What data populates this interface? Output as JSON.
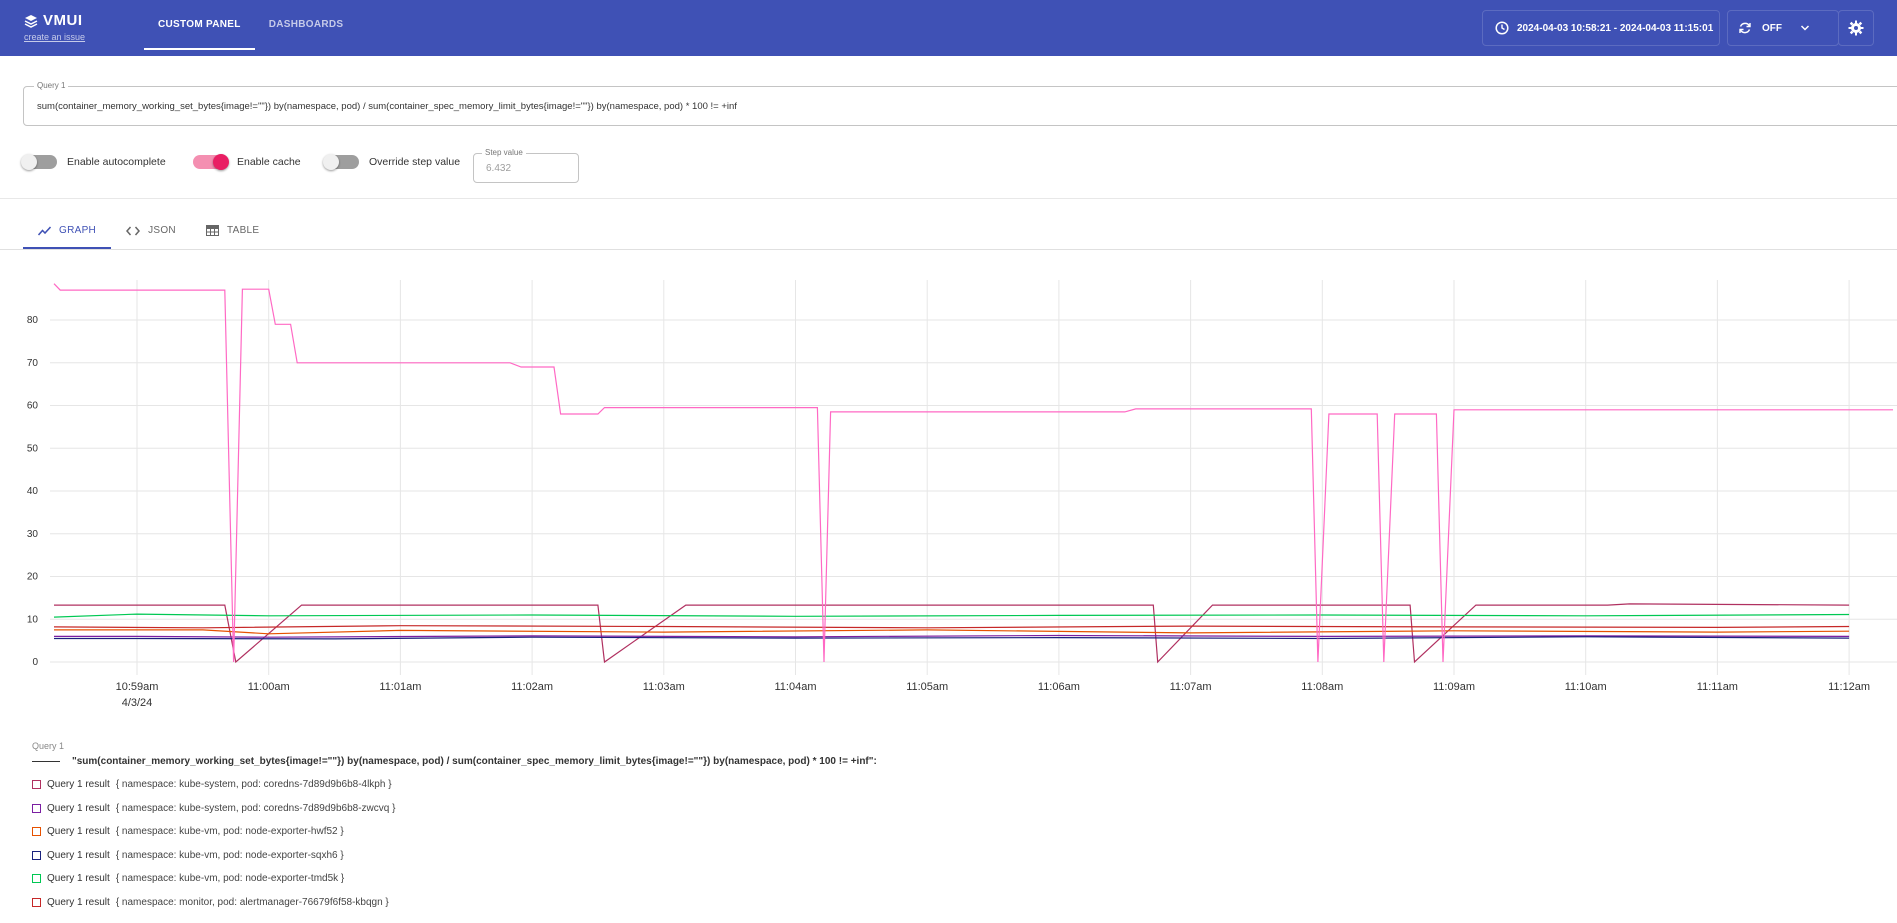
{
  "header": {
    "logo_text": "VMUI",
    "create_issue_link": "create an issue",
    "tabs": [
      {
        "label": "CUSTOM PANEL",
        "active": true
      },
      {
        "label": "DASHBOARDS",
        "active": false
      }
    ],
    "time_range": "2024-04-03 10:58:21 - 2024-04-03 11:15:01",
    "refresh_label": "OFF",
    "icons": {
      "time": "clock-icon",
      "refresh": "refresh-icon",
      "dropdown": "chevron-down-icon",
      "settings": "gear-icon",
      "logo": "layers-icon"
    },
    "background_color": "#3f51b5"
  },
  "query_panel": {
    "query_label": "Query 1",
    "query_value": "sum(container_memory_working_set_bytes{image!=\"\"}) by(namespace, pod) / sum(container_spec_memory_limit_bytes{image!=\"\"}) by(namespace, pod) * 100 != +inf",
    "toggles": [
      {
        "label": "Enable autocomplete",
        "on": false
      },
      {
        "label": "Enable cache",
        "on": true
      },
      {
        "label": "Override step value",
        "on": false
      }
    ],
    "step_label": "Step value",
    "step_value": "6.432"
  },
  "result_tabs": [
    {
      "label": "GRAPH",
      "icon": "line-chart-icon",
      "active": true
    },
    {
      "label": "JSON",
      "icon": "code-icon",
      "active": false
    },
    {
      "label": "TABLE",
      "icon": "table-icon",
      "active": false
    }
  ],
  "chart_data": {
    "type": "line",
    "title": "",
    "xlabel": "",
    "ylabel": "",
    "ylim": [
      0,
      90
    ],
    "y_ticks": [
      0,
      10,
      20,
      30,
      40,
      50,
      60,
      70,
      80
    ],
    "x_ticks": [
      "10:59am",
      "11:00am",
      "11:01am",
      "11:02am",
      "11:03am",
      "11:04am",
      "11:05am",
      "11:06am",
      "11:07am",
      "11:08am",
      "11:09am",
      "11:10am",
      "11:11am",
      "11:12am"
    ],
    "x_date_label": "4/3/24",
    "grid": true,
    "series": [
      {
        "name": "Query 1 result",
        "namespace": "kube-system",
        "pod": "coredns-7d89d9b6b8-4lkph",
        "color": "#b03060",
        "points": [
          [
            "10:58:21",
            13.3
          ],
          [
            "10:59:40",
            13.3
          ],
          [
            "10:59:45",
            0
          ],
          [
            "11:00:15",
            13.3
          ],
          [
            "11:02:30",
            13.3
          ],
          [
            "11:02:33",
            0
          ],
          [
            "11:03:10",
            13.3
          ],
          [
            "11:06:43",
            13.3
          ],
          [
            "11:06:45",
            0
          ],
          [
            "11:07:10",
            13.3
          ],
          [
            "11:08:40",
            13.3
          ],
          [
            "11:08:42",
            0
          ],
          [
            "11:09:10",
            13.3
          ],
          [
            "11:10:10",
            13.3
          ],
          [
            "11:10:20",
            13.6
          ],
          [
            "11:12:00",
            13.3
          ]
        ]
      },
      {
        "name": "Query 1 result",
        "namespace": "kube-system",
        "pod": "coredns-7d89d9b6b8-zwcvq",
        "color": "#7b1fa2",
        "points": [
          [
            "10:58:21",
            6.0
          ],
          [
            "10:59:00",
            6.0
          ],
          [
            "11:00:00",
            5.8
          ],
          [
            "11:02:00",
            6.1
          ],
          [
            "11:04:00",
            5.9
          ],
          [
            "11:06:00",
            6.2
          ],
          [
            "11:08:00",
            6.0
          ],
          [
            "11:10:00",
            6.1
          ],
          [
            "11:12:00",
            6.0
          ]
        ]
      },
      {
        "name": "Query 1 result",
        "namespace": "kube-vm",
        "pod": "node-exporter-hwf52",
        "color": "#e65100",
        "points": [
          [
            "10:58:21",
            7.5
          ],
          [
            "10:59:30",
            7.5
          ],
          [
            "11:00:00",
            6.6
          ],
          [
            "11:01:00",
            7.4
          ],
          [
            "11:03:00",
            7.0
          ],
          [
            "11:05:00",
            7.5
          ],
          [
            "11:07:00",
            6.8
          ],
          [
            "11:09:00",
            7.3
          ],
          [
            "11:11:00",
            7.0
          ],
          [
            "11:12:00",
            7.2
          ]
        ]
      },
      {
        "name": "Query 1 result",
        "namespace": "kube-vm",
        "pod": "node-exporter-sqxh6",
        "color": "#1a237e",
        "points": [
          [
            "10:58:21",
            5.5
          ],
          [
            "10:59:00",
            5.5
          ],
          [
            "11:00:30",
            5.4
          ],
          [
            "11:02:00",
            5.8
          ],
          [
            "11:04:00",
            5.6
          ],
          [
            "11:06:00",
            5.7
          ],
          [
            "11:08:00",
            5.5
          ],
          [
            "11:10:00",
            5.9
          ],
          [
            "11:12:00",
            5.6
          ]
        ]
      },
      {
        "name": "Query 1 result",
        "namespace": "kube-vm",
        "pod": "node-exporter-tmd5k",
        "color": "#00c853",
        "points": [
          [
            "10:58:21",
            10.5
          ],
          [
            "10:59:00",
            11.2
          ],
          [
            "11:00:00",
            10.8
          ],
          [
            "11:02:00",
            11.0
          ],
          [
            "11:04:00",
            10.7
          ],
          [
            "11:06:00",
            10.9
          ],
          [
            "11:08:00",
            11.0
          ],
          [
            "11:10:00",
            10.8
          ],
          [
            "11:12:00",
            11.1
          ]
        ]
      },
      {
        "name": "Query 1 result",
        "namespace": "monitor",
        "pod": "alertmanager-76679f6f58-kbqgn",
        "color": "#c62828",
        "points": [
          [
            "10:58:21",
            8.2
          ],
          [
            "10:59:30",
            8.0
          ],
          [
            "11:01:00",
            8.5
          ],
          [
            "11:03:00",
            8.3
          ],
          [
            "11:05:00",
            8.0
          ],
          [
            "11:07:00",
            8.4
          ],
          [
            "11:09:00",
            8.2
          ],
          [
            "11:11:00",
            8.1
          ],
          [
            "11:12:00",
            8.3
          ]
        ]
      },
      {
        "name": "Query 1 result",
        "namespace": "",
        "pod": "",
        "color": "#ff69c4",
        "points": [
          [
            "10:58:21",
            88.5
          ],
          [
            "10:58:25",
            87.0
          ],
          [
            "10:59:40",
            87.0
          ],
          [
            "10:59:44",
            0
          ],
          [
            "10:59:48",
            87.2
          ],
          [
            "11:00:00",
            87.2
          ],
          [
            "11:00:03",
            79.0
          ],
          [
            "11:00:10",
            79.0
          ],
          [
            "11:00:13",
            70.0
          ],
          [
            "11:01:50",
            70.0
          ],
          [
            "11:01:55",
            69.0
          ],
          [
            "11:02:10",
            69.0
          ],
          [
            "11:02:13",
            58.0
          ],
          [
            "11:02:30",
            58.0
          ],
          [
            "11:02:33",
            59.5
          ],
          [
            "11:04:10",
            59.5
          ],
          [
            "11:04:13",
            0
          ],
          [
            "11:04:16",
            58.5
          ],
          [
            "11:06:30",
            58.5
          ],
          [
            "11:06:35",
            59.2
          ],
          [
            "11:07:55",
            59.2
          ],
          [
            "11:07:58",
            0
          ],
          [
            "11:08:03",
            58.0
          ],
          [
            "11:08:25",
            58.0
          ],
          [
            "11:08:28",
            0
          ],
          [
            "11:08:33",
            58.0
          ],
          [
            "11:08:52",
            58.0
          ],
          [
            "11:08:55",
            0
          ],
          [
            "11:09:00",
            59.0
          ],
          [
            "11:12:20",
            59.0
          ]
        ]
      }
    ]
  },
  "legend": {
    "group_title": "Query 1",
    "query_text": "\"sum(container_memory_working_set_bytes{image!=\"\"}) by(namespace, pod) / sum(container_spec_memory_limit_bytes{image!=\"\"}) by(namespace, pod) * 100 != +inf\":",
    "items": [
      {
        "name": "Query 1 result",
        "labels": "{ namespace: kube-system,  pod: coredns-7d89d9b6b8-4lkph }",
        "color": "#b03060"
      },
      {
        "name": "Query 1 result",
        "labels": "{ namespace: kube-system,  pod: coredns-7d89d9b6b8-zwcvq }",
        "color": "#7b1fa2"
      },
      {
        "name": "Query 1 result",
        "labels": "{ namespace: kube-vm,  pod: node-exporter-hwf52 }",
        "color": "#e65100"
      },
      {
        "name": "Query 1 result",
        "labels": "{ namespace: kube-vm,  pod: node-exporter-sqxh6 }",
        "color": "#1a237e"
      },
      {
        "name": "Query 1 result",
        "labels": "{ namespace: kube-vm,  pod: node-exporter-tmd5k }",
        "color": "#00c853"
      },
      {
        "name": "Query 1 result",
        "labels": "{ namespace: monitor,  pod: alertmanager-76679f6f58-kbqgn }",
        "color": "#c62828"
      }
    ]
  }
}
